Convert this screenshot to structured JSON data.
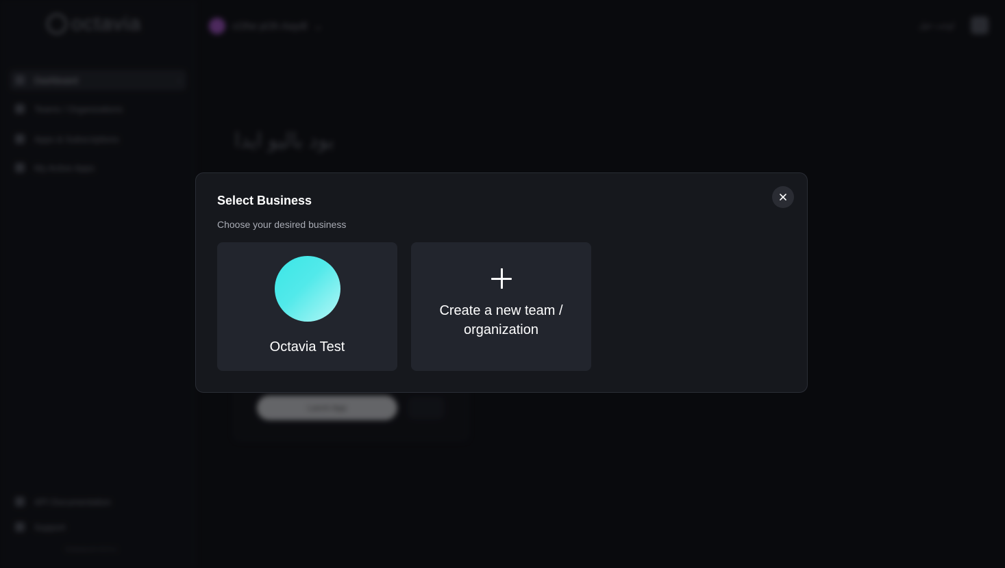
{
  "app": {
    "logo_text": "octavia",
    "org_switcher": "cOhe pOh Aaydl",
    "topbar_text": "اوخت خیل",
    "background_heading": "بود بالیو ایدا",
    "launch_button": "Lanch App",
    "sidebar": {
      "items": [
        {
          "label": "Dashboard",
          "icon": "grid-icon",
          "active": true
        },
        {
          "label": "Teams / Organizations",
          "icon": "team-icon",
          "active": false
        },
        {
          "label": "Apps & Subscriptions",
          "icon": "apps-icon",
          "active": false
        },
        {
          "label": "My Active Apps",
          "icon": "active-apps-icon",
          "active": false
        }
      ],
      "footer_items": [
        {
          "label": "API Documentation",
          "icon": "doc-icon"
        },
        {
          "label": "Support",
          "icon": "support-icon"
        }
      ],
      "version": "Octavia Ai V2.0.1"
    }
  },
  "modal": {
    "title": "Select Business",
    "subtitle": "Choose your desired business",
    "close_icon": "close-icon",
    "businesses": [
      {
        "name": "Octavia Test",
        "avatar_colors": [
          "#3be6e6",
          "#b6f7f6"
        ]
      }
    ],
    "create_label": "Create a new team / organization"
  }
}
